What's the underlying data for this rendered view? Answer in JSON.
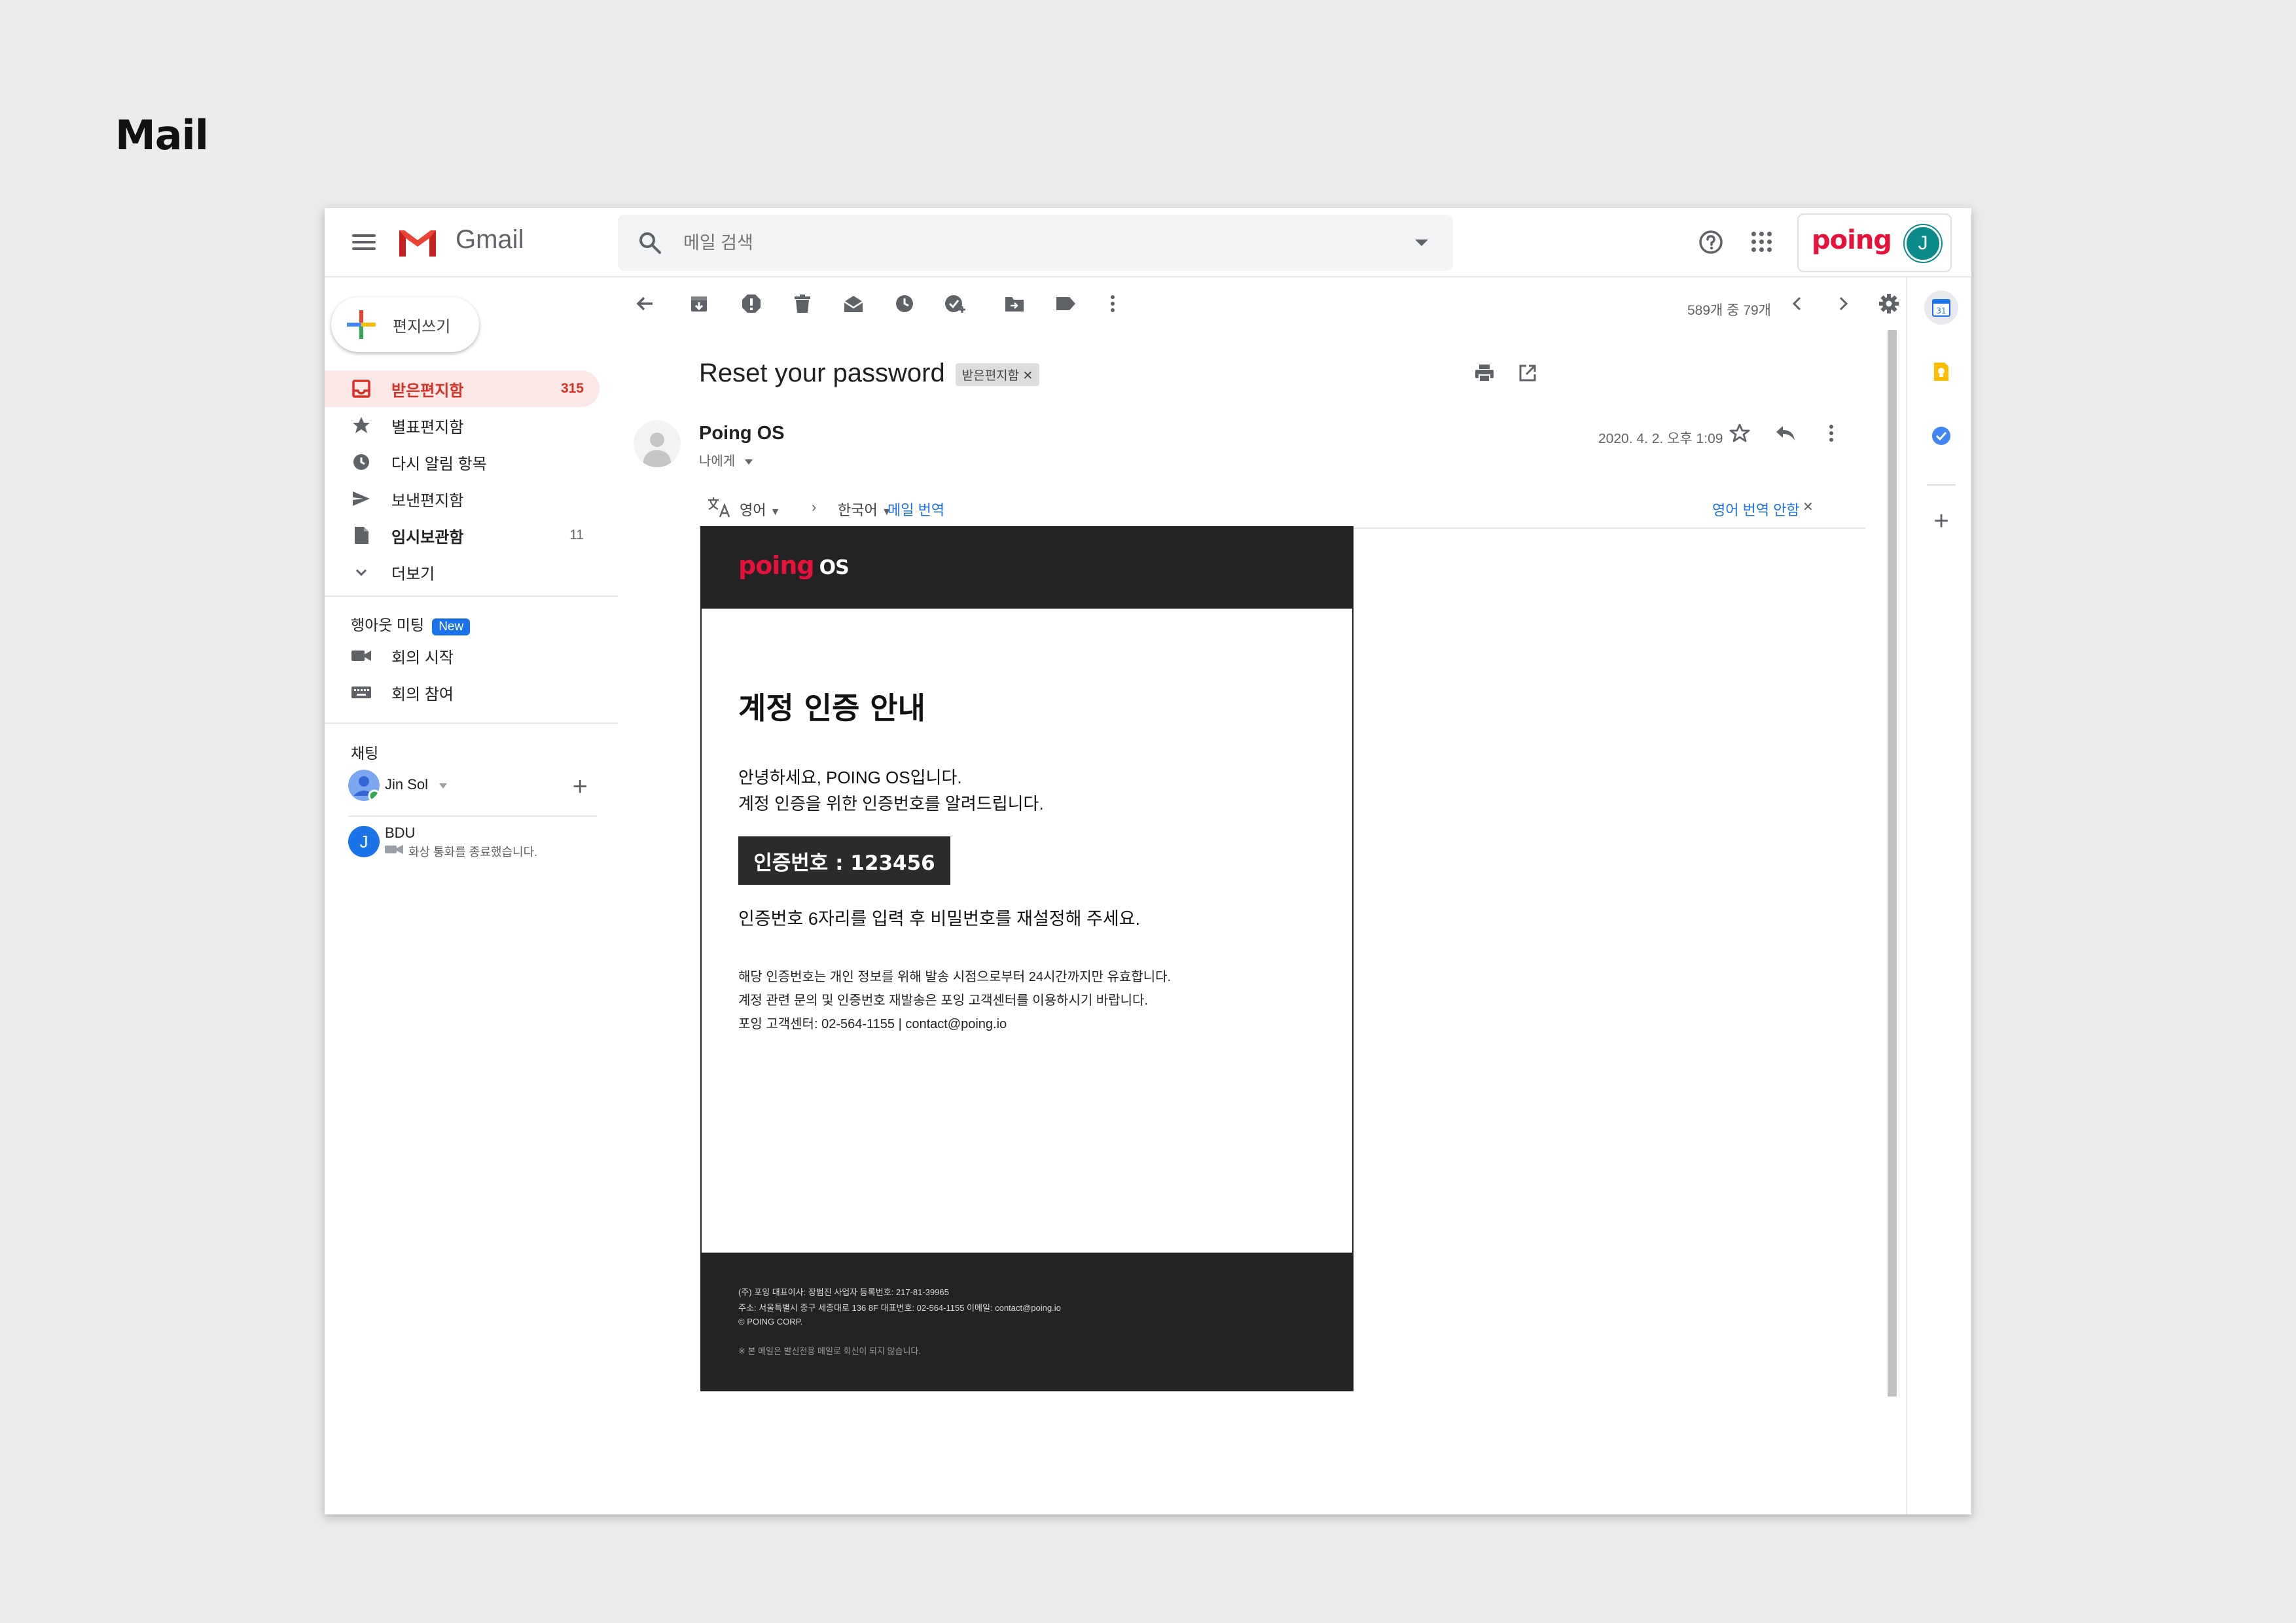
{
  "page": {
    "heading": "Mail"
  },
  "app": {
    "name": "Gmail",
    "brand": "poing"
  },
  "search": {
    "placeholder": "메일 검색"
  },
  "account": {
    "avatar_letter": "J"
  },
  "compose": {
    "label": "편지쓰기"
  },
  "sidebar": {
    "items": [
      {
        "label": "받은편지함",
        "count": "315",
        "icon": "inbox-icon"
      },
      {
        "label": "별표편지함",
        "count": "",
        "icon": "star-icon"
      },
      {
        "label": "다시 알림 항목",
        "count": "",
        "icon": "clock-icon"
      },
      {
        "label": "보낸편지함",
        "count": "",
        "icon": "send-icon"
      },
      {
        "label": "임시보관함",
        "count": "11",
        "icon": "draft-icon"
      },
      {
        "label": "더보기",
        "count": "",
        "icon": "chevron-down-icon"
      }
    ],
    "meet": {
      "title": "행아웃 미팅",
      "badge": "New",
      "items": [
        {
          "label": "회의 시작",
          "icon": "video-icon"
        },
        {
          "label": "회의 참여",
          "icon": "keyboard-icon"
        }
      ]
    },
    "chat": {
      "title": "채팅",
      "self_name": "Jin Sol",
      "contact_name": "BDU",
      "contact_letter": "J",
      "contact_status": "화상 통화를 종료했습니다."
    }
  },
  "toolbar": {
    "page_count": "589개 중 79개"
  },
  "message": {
    "subject": "Reset your password",
    "label": "받은편지함",
    "sender": "Poing OS",
    "to": "나에게",
    "date": "2020. 4. 2. 오후 1:09"
  },
  "translate": {
    "from": "영어",
    "to": "한국어",
    "action": "메일 번역",
    "disable": "영어 번역 안함"
  },
  "email": {
    "logo_main": "poing",
    "logo_os": "OS",
    "title": "계정 인증 안내",
    "greeting": "안녕하세요, POING OS입니다.",
    "intro": "계정 인증을 위한 인증번호를 알려드립니다.",
    "code": "인증번호 : 123456",
    "instruction": "인증번호 6자리를 입력 후 비밀번호를 재설정해 주세요.",
    "note1": "해당 인증번호는 개인 정보를 위해 발송 시점으로부터 24시간까지만 유효합니다.",
    "note2": "계정 관련 문의 및 인증번호 재발송은 포잉 고객센터를 이용하시기 바랍니다.",
    "note3": "포잉 고객센터: 02-564-1155   |   contact@poing.io",
    "footer1": "(주) 포잉     대표이사: 장범진     사업자 등록번호: 217-81-39965",
    "footer2": "주소: 서울특별시 중구 세종대로 136 8F     대표번호: 02-564-1155     이메일: contact@poing.io",
    "footer3": "© POING CORP.",
    "footer4": "※ 본 메일은 발신전용 메일로 회신이 되지 않습니다."
  },
  "colors": {
    "accent": "#d93025",
    "brand": "#e8113a",
    "link": "#1a73e8",
    "dark": "#232323"
  }
}
